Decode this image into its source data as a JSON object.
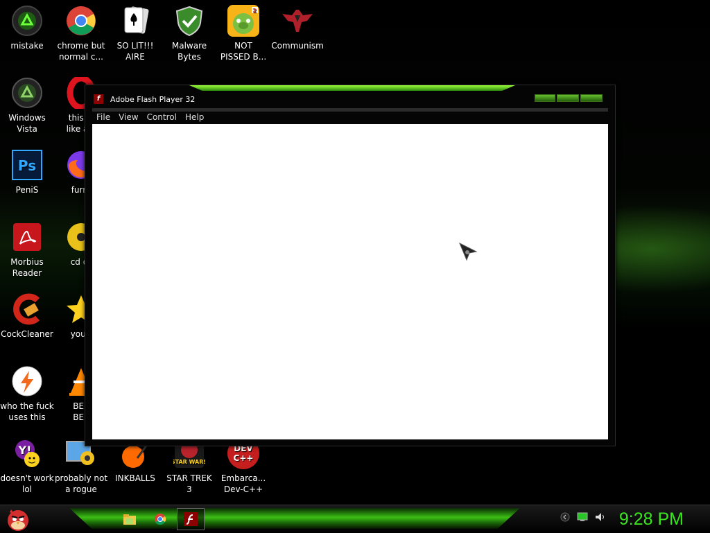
{
  "desktop": {
    "icons": [
      {
        "label": "mistake",
        "icon": "recycle-green-icon"
      },
      {
        "label": "chrome but\nnormal c...",
        "icon": "chrome-icon"
      },
      {
        "label": "SO LIT!!!\nAIRE",
        "icon": "solitaire-icon"
      },
      {
        "label": "Malware\nBytes",
        "icon": "shield-check-icon"
      },
      {
        "label": "NOT\nPISSED B...",
        "icon": "pig-icon"
      },
      {
        "label": "Communism",
        "icon": "eagle-logo-icon"
      },
      {
        "label": "Windows\nVista",
        "icon": "recycle-bin-icon"
      },
      {
        "label": "this lo\nlike a v",
        "icon": "opera-icon"
      },
      {
        "label": "PeniS",
        "icon": "photoshop-icon"
      },
      {
        "label": "furry",
        "icon": "firefox-icon"
      },
      {
        "label": "Morbius\nReader",
        "icon": "pdf-reader-icon"
      },
      {
        "label": "cd dr",
        "icon": "cd-icon"
      },
      {
        "label": "CockCleaner",
        "icon": "ccleaner-icon"
      },
      {
        "label": "you t",
        "icon": "star-icon"
      },
      {
        "label": "who the fuck\nuses this",
        "icon": "winamp-icon"
      },
      {
        "label": "BEE\nBEE",
        "icon": "vlc-icon"
      },
      {
        "label": "doesn't work\nlol",
        "icon": "yahoo-icon"
      },
      {
        "label": "probably not\na rogue",
        "icon": "settings-monitor-icon"
      },
      {
        "label": "INKBALLS",
        "icon": "inkball-icon"
      },
      {
        "label": "STAR TREK\n3",
        "icon": "star-wars-icon"
      },
      {
        "label": "Embarca...\nDev-C++",
        "icon": "devcpp-icon"
      }
    ]
  },
  "window": {
    "title": "Adobe Flash Player 32",
    "menu": [
      "File",
      "View",
      "Control",
      "Help"
    ]
  },
  "taskbar": {
    "clock": "9:28 PM",
    "items": [
      "file-explorer-icon",
      "chrome-icon",
      "flash-player-icon"
    ]
  },
  "colors": {
    "accent": "#39e61e",
    "window_bg": "#050505",
    "content_bg": "#ffffff"
  }
}
